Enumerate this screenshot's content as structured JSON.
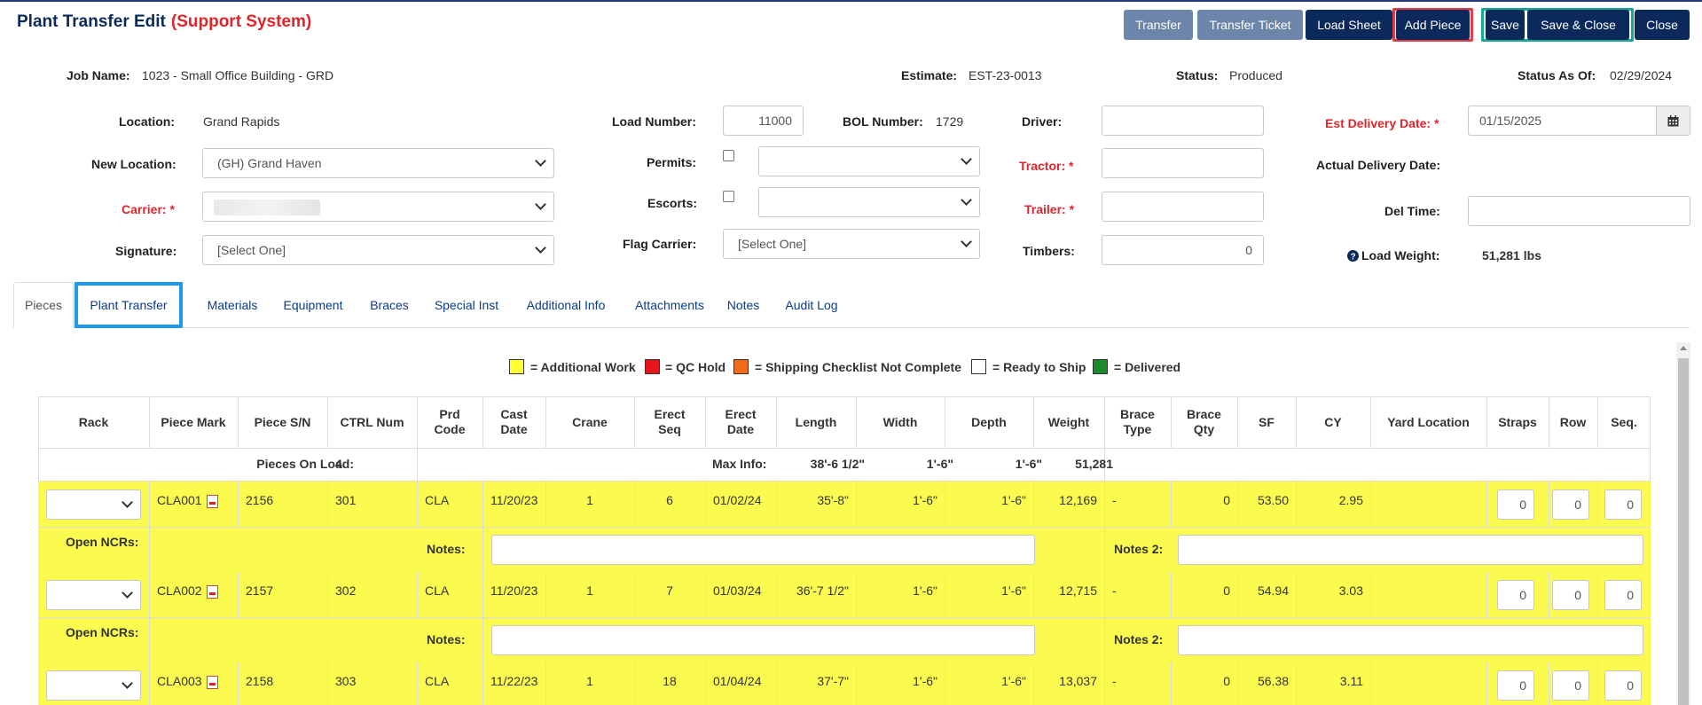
{
  "header": {
    "title": "Plant Transfer Edit",
    "subtitle": "(Support System)",
    "buttons": [
      "Transfer",
      "Transfer Ticket",
      "Load Sheet",
      "Add Piece",
      "Save",
      "Save & Close",
      "Close"
    ]
  },
  "summary": {
    "job_name_label": "Job Name:",
    "job_name": "1023 - Small Office Building - GRD",
    "estimate_label": "Estimate:",
    "estimate": "EST-23-0013",
    "status_label": "Status:",
    "status": "Produced",
    "status_as_of_label": "Status As Of:",
    "status_as_of": "02/29/2024"
  },
  "form": {
    "location_label": "Location:",
    "location": "Grand Rapids",
    "new_location_label": "New Location:",
    "new_location": "(GH) Grand Haven",
    "carrier_label": "Carrier:",
    "signature_label": "Signature:",
    "signature": "[Select One]",
    "load_number_label": "Load Number:",
    "load_number": "11000",
    "bol_number_label": "BOL Number:",
    "bol_number": "1729",
    "permits_label": "Permits:",
    "escorts_label": "Escorts:",
    "flag_carrier_label": "Flag Carrier:",
    "flag_carrier": "[Select One]",
    "driver_label": "Driver:",
    "tractor_label": "Tractor:",
    "trailer_label": "Trailer:",
    "timbers_label": "Timbers:",
    "timbers": "0",
    "est_delivery_label": "Est Delivery Date:",
    "est_delivery": "01/15/2025",
    "actual_delivery_label": "Actual Delivery Date:",
    "del_time_label": "Del Time:",
    "load_weight_label": "Load Weight:",
    "load_weight": "51,281 lbs",
    "required_mark": "*"
  },
  "tabs": [
    "Pieces",
    "Plant Transfer",
    "Materials",
    "Equipment",
    "Braces",
    "Special Inst",
    "Additional Info",
    "Attachments",
    "Notes",
    "Audit Log"
  ],
  "legend": [
    {
      "text": "= Additional Work",
      "color": "#ffff33"
    },
    {
      "text": "= QC Hold",
      "color": "#e8141c"
    },
    {
      "text": "= Shipping Checklist Not Complete",
      "color": "#f26a1b"
    },
    {
      "text": "= Ready to Ship",
      "color": "#ffffff"
    },
    {
      "text": "= Delivered",
      "color": "#1a8a2a"
    }
  ],
  "table": {
    "columns": [
      "Rack",
      "Piece Mark",
      "Piece S/N",
      "CTRL Num",
      "Prd\nCode",
      "Cast\nDate",
      "Crane",
      "Erect\nSeq",
      "Erect\nDate",
      "Length",
      "Width",
      "Depth",
      "Weight",
      "Brace\nType",
      "Brace\nQty",
      "SF",
      "CY",
      "Yard Location",
      "Straps",
      "Row",
      "Seq."
    ],
    "summary": {
      "pieces_on_load_label": "Pieces On Load:",
      "pieces_on_load": "4",
      "max_info_label": "Max Info:",
      "max_length": "38'-6 1/2\"",
      "max_width": "1'-6\"",
      "max_depth": "1'-6\"",
      "max_weight": "51,281"
    },
    "sub_labels": {
      "open_ncrs": "Open NCRs:",
      "notes": "Notes:",
      "notes2": "Notes 2:"
    },
    "rows": [
      {
        "mark": "CLA001",
        "sn": "2156",
        "ctrl": "301",
        "prd": "CLA",
        "cast": "11/20/23",
        "crane": "1",
        "erect_seq": "6",
        "erect_date": "01/02/24",
        "length": "35'-8\"",
        "width": "1'-6\"",
        "depth": "1'-6\"",
        "weight": "12,169",
        "brace_type": "-",
        "brace_qty": "0",
        "sf": "53.50",
        "cy": "2.95",
        "straps": "0",
        "row": "0",
        "seq": "0"
      },
      {
        "mark": "CLA002",
        "sn": "2157",
        "ctrl": "302",
        "prd": "CLA",
        "cast": "11/20/23",
        "crane": "1",
        "erect_seq": "7",
        "erect_date": "01/03/24",
        "length": "36'-7 1/2\"",
        "width": "1'-6\"",
        "depth": "1'-6\"",
        "weight": "12,715",
        "brace_type": "-",
        "brace_qty": "0",
        "sf": "54.94",
        "cy": "3.03",
        "straps": "0",
        "row": "0",
        "seq": "0"
      },
      {
        "mark": "CLA003",
        "sn": "2158",
        "ctrl": "303",
        "prd": "CLA",
        "cast": "11/22/23",
        "crane": "1",
        "erect_seq": "18",
        "erect_date": "01/04/24",
        "length": "37'-7\"",
        "width": "1'-6\"",
        "depth": "1'-6\"",
        "weight": "13,037",
        "brace_type": "-",
        "brace_qty": "0",
        "sf": "56.38",
        "cy": "3.11",
        "straps": "0",
        "row": "0",
        "seq": "0"
      }
    ]
  },
  "colors": {
    "brand": "#0b2a5b",
    "required": "#e0242b",
    "row_highlight": "#fbfb4f",
    "tab_highlight": "#1e9be8"
  }
}
